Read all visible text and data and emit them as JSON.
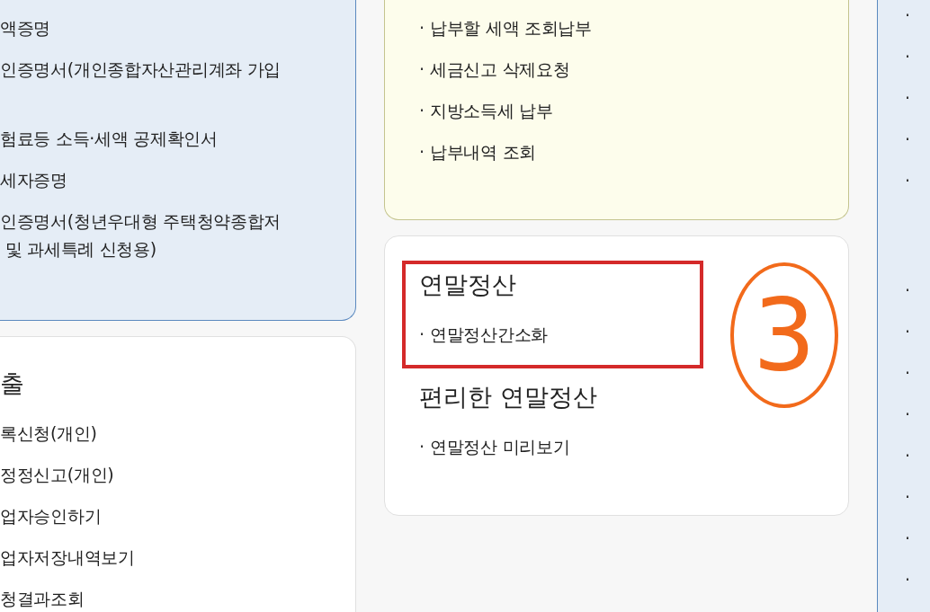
{
  "left_column": {
    "certificate_panel": {
      "items": [
        {
          "lines": [
            "액증명"
          ]
        },
        {
          "lines": [
            "인증명서(개인종합자산관리계좌 가입"
          ]
        },
        {
          "lines": [
            "험료등 소득·세액 공제확인서"
          ]
        },
        {
          "lines": [
            "세자증명"
          ]
        },
        {
          "lines": [
            "인증명서(청년우대형 주택청약종합저",
            " 및 과세특례 신청용)"
          ]
        }
      ]
    },
    "submission_card": {
      "title": "출",
      "items": [
        "록신청(개인)",
        "정정신고(개인)",
        "업자승인하기",
        "업자저장내역보기",
        "청결과조회"
      ]
    }
  },
  "middle_column": {
    "payment_panel": {
      "bullet": "·",
      "items": [
        "납부할 세액 조회납부",
        "세금신고 삭제요청",
        "지방소득세 납부",
        "납부내역 조회"
      ]
    },
    "year_end_card": {
      "bullet": "·",
      "sections": [
        {
          "title": "연말정산",
          "items": [
            "연말정산간소화"
          ]
        },
        {
          "title": "편리한 연말정산",
          "items": [
            "연말정산 미리보기"
          ]
        }
      ]
    }
  },
  "right_column": {
    "bullets": [
      "·",
      "·",
      "·",
      "·",
      "·"
    ],
    "bullets_2": [
      "·",
      "·",
      "·",
      "·",
      "·",
      "·",
      "·",
      "·"
    ]
  },
  "annotations": [
    {
      "kind": "box"
    },
    {
      "kind": "circled_number",
      "label": "3"
    }
  ]
}
